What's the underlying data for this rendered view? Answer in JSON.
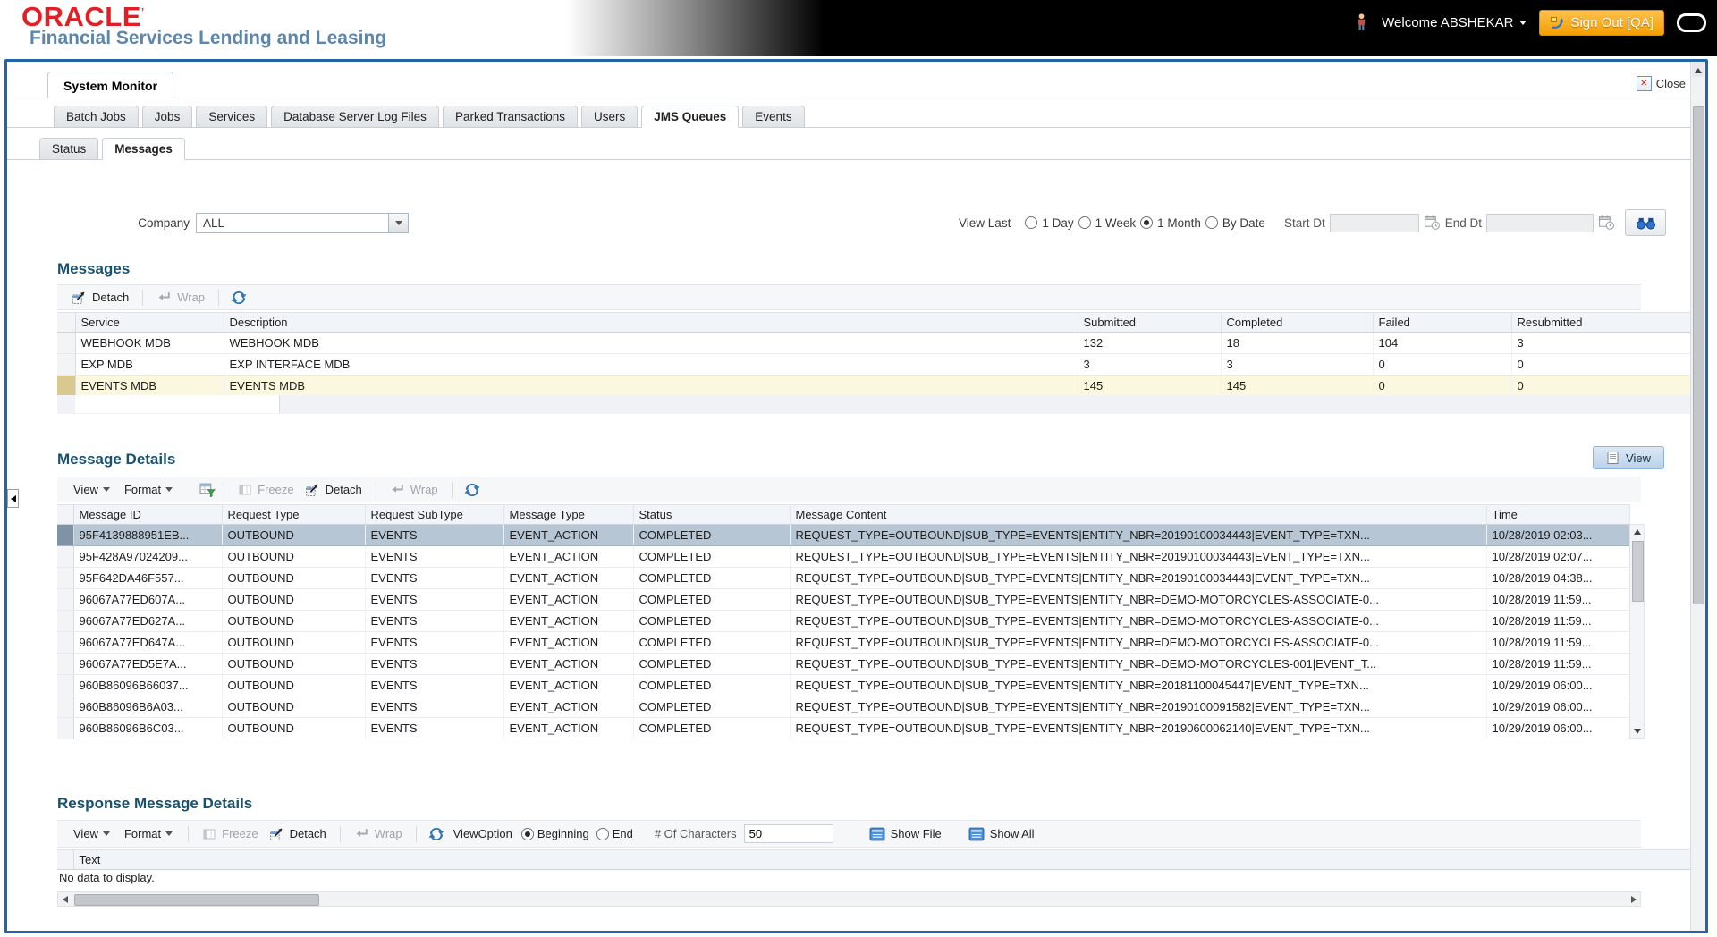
{
  "colors": {
    "accent_blue": "#2166ac",
    "heading": "#17516e",
    "oracle_red": "#e21f26",
    "brand_blue": "#5d86ad",
    "signout_orange": "#f59e00",
    "selected_yellow": "#fcf7df",
    "selected_blue": "#b7c6d5"
  },
  "header": {
    "logo": "ORACLE",
    "logo_mark": "’",
    "subtitle": "Financial Services Lending and Leasing",
    "welcome": "Welcome ABSHEKAR",
    "sign_out": "Sign Out [QA]"
  },
  "window": {
    "title_tab": "System Monitor",
    "close_label": "Close",
    "tabs": [
      "Batch Jobs",
      "Jobs",
      "Services",
      "Database Server Log Files",
      "Parked Transactions",
      "Users",
      "JMS Queues",
      "Events"
    ],
    "active_tab": "JMS Queues",
    "subtabs": [
      "Status",
      "Messages"
    ],
    "active_subtab": "Messages"
  },
  "filters": {
    "company_label": "Company",
    "company_value": "ALL",
    "view_last_label": "View Last",
    "options": [
      "1 Day",
      "1 Week",
      "1 Month",
      "By Date"
    ],
    "selected": "1 Month",
    "start_label": "Start Dt",
    "start_value": "",
    "end_label": "End Dt",
    "end_value": ""
  },
  "messages": {
    "title": "Messages",
    "toolbar": {
      "detach": "Detach",
      "wrap": "Wrap"
    },
    "columns": [
      "Service",
      "Description",
      "Submitted",
      "Completed",
      "Failed",
      "Resubmitted"
    ],
    "rows": [
      {
        "service": "WEBHOOK MDB",
        "description": "WEBHOOK MDB",
        "submitted": "132",
        "completed": "18",
        "failed": "104",
        "resubmitted": "3"
      },
      {
        "service": "EXP MDB",
        "description": "EXP INTERFACE MDB",
        "submitted": "3",
        "completed": "3",
        "failed": "0",
        "resubmitted": "0"
      },
      {
        "service": "EVENTS MDB",
        "description": "EVENTS MDB",
        "submitted": "145",
        "completed": "145",
        "failed": "0",
        "resubmitted": "0"
      }
    ],
    "selected_row": "EVENTS MDB"
  },
  "message_details": {
    "title": "Message Details",
    "view_button": "View",
    "toolbar": {
      "view": "View",
      "format": "Format",
      "freeze": "Freeze",
      "detach": "Detach",
      "wrap": "Wrap"
    },
    "columns": [
      "Message ID",
      "Request Type",
      "Request SubType",
      "Message Type",
      "Status",
      "Message Content",
      "Time"
    ],
    "rows": [
      {
        "id": "95F4139888951EB...",
        "request_type": "OUTBOUND",
        "sub_type": "EVENTS",
        "msg_type": "EVENT_ACTION",
        "status": "COMPLETED",
        "content": "REQUEST_TYPE=OUTBOUND|SUB_TYPE=EVENTS|ENTITY_NBR=20190100034443|EVENT_TYPE=TXN...",
        "time": "10/28/2019 02:03..."
      },
      {
        "id": "95F428A97024209...",
        "request_type": "OUTBOUND",
        "sub_type": "EVENTS",
        "msg_type": "EVENT_ACTION",
        "status": "COMPLETED",
        "content": "REQUEST_TYPE=OUTBOUND|SUB_TYPE=EVENTS|ENTITY_NBR=20190100034443|EVENT_TYPE=TXN...",
        "time": "10/28/2019 02:07..."
      },
      {
        "id": "95F642DA46F557...",
        "request_type": "OUTBOUND",
        "sub_type": "EVENTS",
        "msg_type": "EVENT_ACTION",
        "status": "COMPLETED",
        "content": "REQUEST_TYPE=OUTBOUND|SUB_TYPE=EVENTS|ENTITY_NBR=20190100034443|EVENT_TYPE=TXN...",
        "time": "10/28/2019 04:38..."
      },
      {
        "id": "96067A77ED607A...",
        "request_type": "OUTBOUND",
        "sub_type": "EVENTS",
        "msg_type": "EVENT_ACTION",
        "status": "COMPLETED",
        "content": "REQUEST_TYPE=OUTBOUND|SUB_TYPE=EVENTS|ENTITY_NBR=DEMO-MOTORCYCLES-ASSOCIATE-0...",
        "time": "10/28/2019 11:59..."
      },
      {
        "id": "96067A77ED627A...",
        "request_type": "OUTBOUND",
        "sub_type": "EVENTS",
        "msg_type": "EVENT_ACTION",
        "status": "COMPLETED",
        "content": "REQUEST_TYPE=OUTBOUND|SUB_TYPE=EVENTS|ENTITY_NBR=DEMO-MOTORCYCLES-ASSOCIATE-0...",
        "time": "10/28/2019 11:59..."
      },
      {
        "id": "96067A77ED647A...",
        "request_type": "OUTBOUND",
        "sub_type": "EVENTS",
        "msg_type": "EVENT_ACTION",
        "status": "COMPLETED",
        "content": "REQUEST_TYPE=OUTBOUND|SUB_TYPE=EVENTS|ENTITY_NBR=DEMO-MOTORCYCLES-ASSOCIATE-0...",
        "time": "10/28/2019 11:59..."
      },
      {
        "id": "96067A77ED5E7A...",
        "request_type": "OUTBOUND",
        "sub_type": "EVENTS",
        "msg_type": "EVENT_ACTION",
        "status": "COMPLETED",
        "content": "REQUEST_TYPE=OUTBOUND|SUB_TYPE=EVENTS|ENTITY_NBR=DEMO-MOTORCYCLES-001|EVENT_T...",
        "time": "10/28/2019 11:59..."
      },
      {
        "id": "960B86096B66037...",
        "request_type": "OUTBOUND",
        "sub_type": "EVENTS",
        "msg_type": "EVENT_ACTION",
        "status": "COMPLETED",
        "content": "REQUEST_TYPE=OUTBOUND|SUB_TYPE=EVENTS|ENTITY_NBR=20181100045447|EVENT_TYPE=TXN...",
        "time": "10/29/2019 06:00..."
      },
      {
        "id": "960B86096B6A03...",
        "request_type": "OUTBOUND",
        "sub_type": "EVENTS",
        "msg_type": "EVENT_ACTION",
        "status": "COMPLETED",
        "content": "REQUEST_TYPE=OUTBOUND|SUB_TYPE=EVENTS|ENTITY_NBR=20190100091582|EVENT_TYPE=TXN...",
        "time": "10/29/2019 06:00..."
      },
      {
        "id": "960B86096B6C03...",
        "request_type": "OUTBOUND",
        "sub_type": "EVENTS",
        "msg_type": "EVENT_ACTION",
        "status": "COMPLETED",
        "content": "REQUEST_TYPE=OUTBOUND|SUB_TYPE=EVENTS|ENTITY_NBR=20190600062140|EVENT_TYPE=TXN...",
        "time": "10/29/2019 06:00..."
      }
    ],
    "selected_row": "95F4139888951EB..."
  },
  "response_details": {
    "title": "Response Message Details",
    "toolbar": {
      "view": "View",
      "format": "Format",
      "freeze": "Freeze",
      "detach": "Detach",
      "wrap": "Wrap",
      "view_option_label": "ViewOption",
      "options": [
        "Beginning",
        "End"
      ],
      "selected": "Beginning",
      "chars_label": "# Of Characters",
      "chars_value": "50",
      "show_file": "Show File",
      "show_all": "Show All"
    },
    "columns": [
      "Text"
    ],
    "empty_text": "No data to display."
  }
}
